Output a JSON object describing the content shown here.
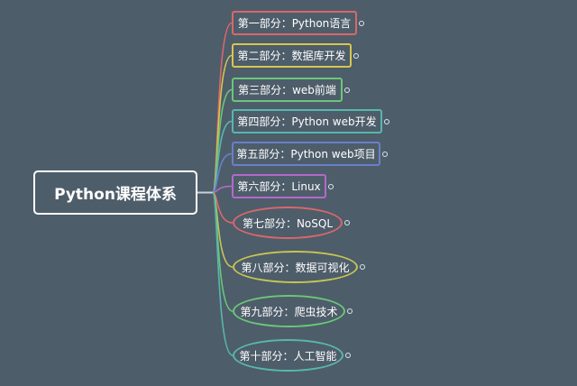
{
  "root": {
    "label": "Python课程体系",
    "connector_color": "#c9d0d6"
  },
  "branches": [
    {
      "label": "第一部分：Python语言",
      "color": "#d9686a",
      "shape": "rect"
    },
    {
      "label": "第二部分：数据库开发",
      "color": "#d6c650",
      "shape": "rect"
    },
    {
      "label": "第三部分：web前端",
      "color": "#6ac77a",
      "shape": "rect"
    },
    {
      "label": "第四部分：Python web开发",
      "color": "#58b7ad",
      "shape": "rect"
    },
    {
      "label": "第五部分：Python web项目",
      "color": "#6b7fc9",
      "shape": "rect"
    },
    {
      "label": "第六部分：Linux",
      "color": "#b36ac9",
      "shape": "rect"
    },
    {
      "label": "第七部分：NoSQL",
      "color": "#d9686a",
      "shape": "ellipse"
    },
    {
      "label": "第八部分：数据可视化",
      "color": "#c7c454",
      "shape": "ellipse"
    },
    {
      "label": "第九部分：爬虫技术",
      "color": "#6ac77a",
      "shape": "ellipse"
    },
    {
      "label": "第十部分：人工智能",
      "color": "#58b7ad",
      "shape": "ellipse"
    }
  ]
}
